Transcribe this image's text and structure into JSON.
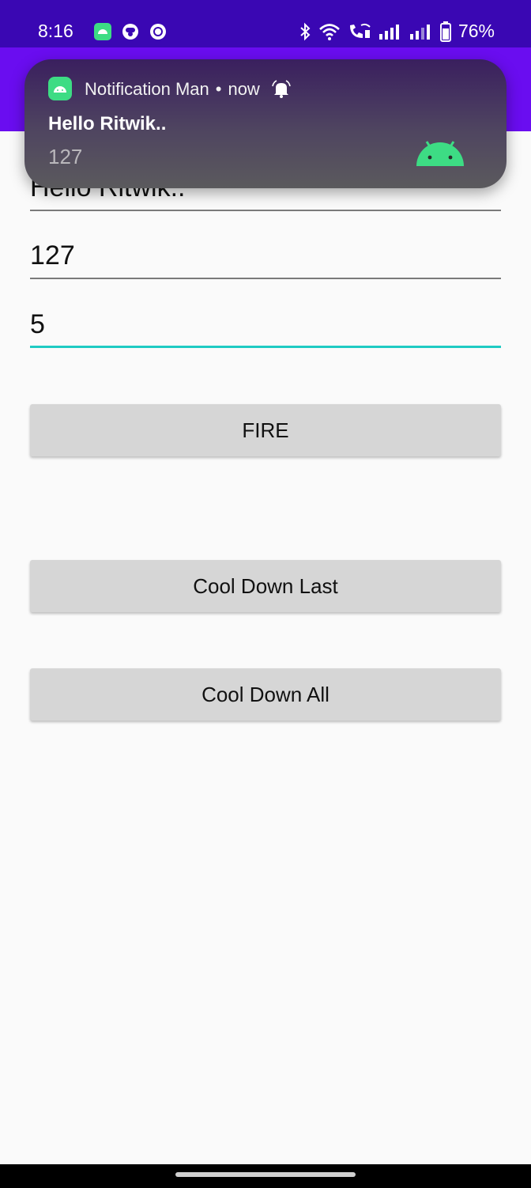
{
  "status_bar": {
    "time": "8:16",
    "battery": "76%",
    "left_icons": [
      "android-app-icon",
      "face-icon",
      "circle-icon"
    ],
    "right_icons": [
      "bluetooth-icon",
      "wifi-icon",
      "wifi-calling-icon",
      "signal-icon",
      "signal-weak-icon",
      "battery-icon"
    ]
  },
  "notification": {
    "app_name": "Notification Man",
    "separator": "•",
    "when": "now",
    "title": "Hello Ritwik..",
    "text": "127",
    "accent_color": "#3ddc84"
  },
  "form": {
    "title_value": "Hello Ritwik..",
    "message_value": "127",
    "count_value": "5"
  },
  "buttons": {
    "fire": "FIRE",
    "cool_down_last": "Cool Down Last",
    "cool_down_all": "Cool Down All"
  },
  "colors": {
    "status_bar": "#3a07b3",
    "app_bar": "#6a0df0",
    "focus_underline": "#1fcbc3"
  }
}
